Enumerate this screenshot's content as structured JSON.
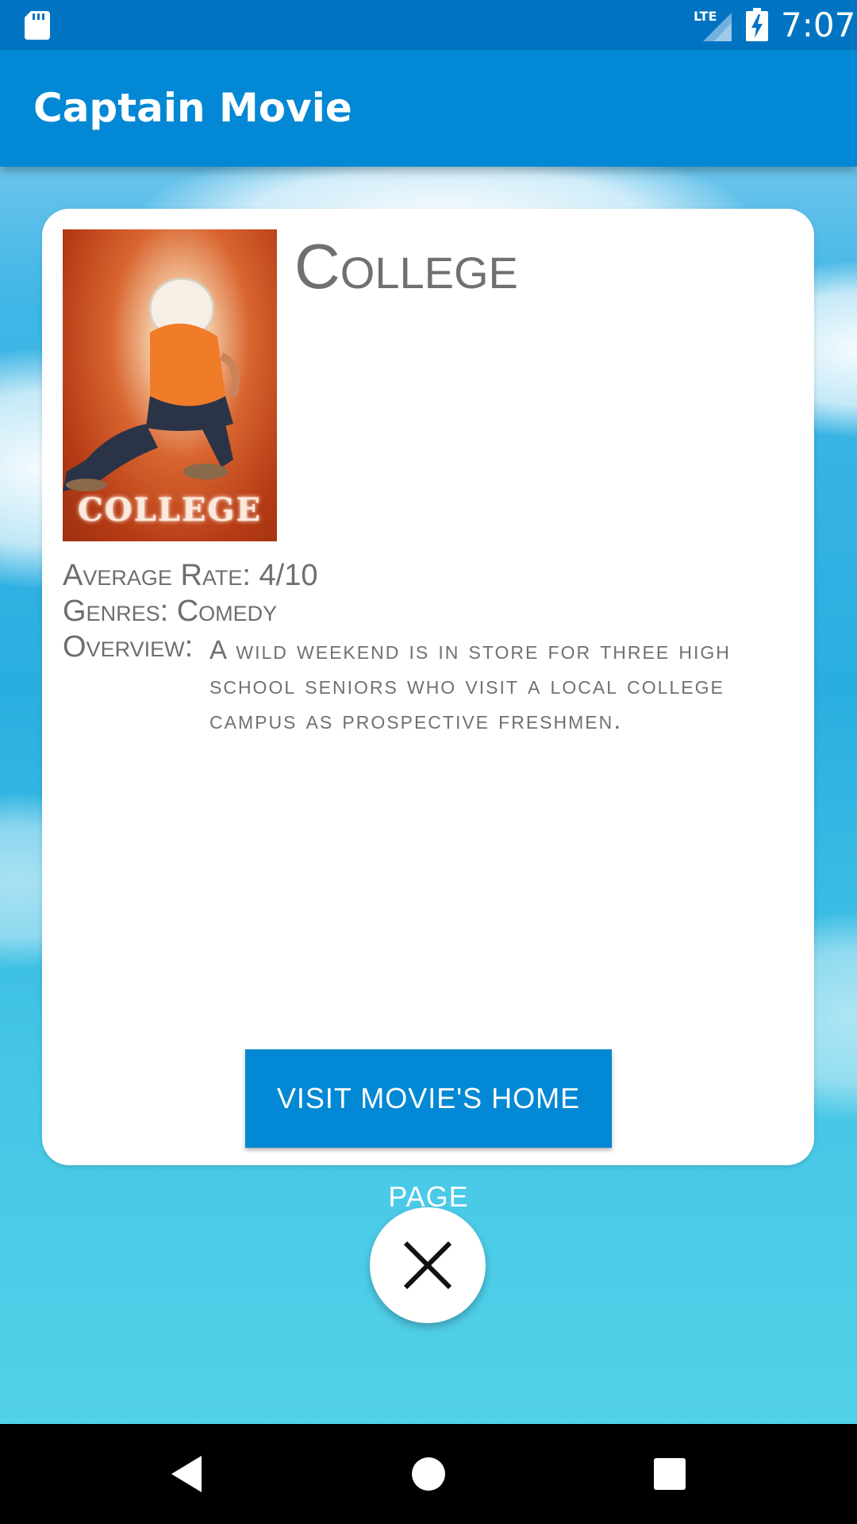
{
  "status_bar": {
    "time": "7:07",
    "network_label": "LTE",
    "icons": [
      "sd-card-icon",
      "lte-signal-icon",
      "battery-charging-icon"
    ]
  },
  "app_bar": {
    "title": "Captain Movie"
  },
  "movie": {
    "title": "College",
    "poster_text": "COLLEGE",
    "average_rate_label": "Average Rate:",
    "average_rate_value": "4/10",
    "genres_label": "Genres:",
    "genres_value": "Comedy",
    "overview_label": "Overview:",
    "overview_text": "A wild weekend is in store for three high school seniors who visit a local college campus as prospective freshmen.",
    "home_page_button": "VISIT MOVIE'S HOME PAGE"
  },
  "actions": {
    "close_icon": "close-icon"
  },
  "nav_bar": {
    "icons": [
      "back-icon",
      "home-icon",
      "recents-icon"
    ]
  },
  "colors": {
    "status_bar": "#0074c2",
    "app_bar": "#0288d4",
    "button": "#0288d4",
    "text_gray": "#707070",
    "card": "#ffffff"
  }
}
